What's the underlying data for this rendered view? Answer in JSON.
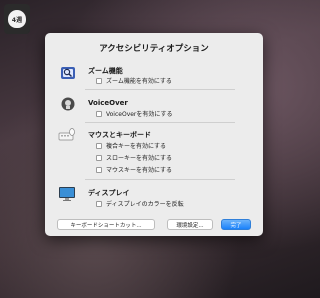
{
  "badge": {
    "text": "4週"
  },
  "dialog": {
    "title": "アクセシビリティオプション",
    "sections": [
      {
        "title": "ズーム機能",
        "icon": "zoom-icon",
        "options": [
          "ズーム機能を有効にする"
        ]
      },
      {
        "title": "VoiceOver",
        "icon": "voiceover-icon",
        "options": [
          "VoiceOverを有効にする"
        ]
      },
      {
        "title": "マウスとキーボード",
        "icon": "mouse-keyboard-icon",
        "options": [
          "複合キーを有効にする",
          "スローキーを有効にする",
          "マウスキーを有効にする"
        ]
      },
      {
        "title": "ディスプレイ",
        "icon": "display-icon",
        "options": [
          "ディスプレイのカラーを反転"
        ]
      }
    ],
    "buttons": {
      "keyboard_shortcuts": "キーボードショートカット...",
      "preferences": "環境設定...",
      "done": "完了"
    }
  }
}
